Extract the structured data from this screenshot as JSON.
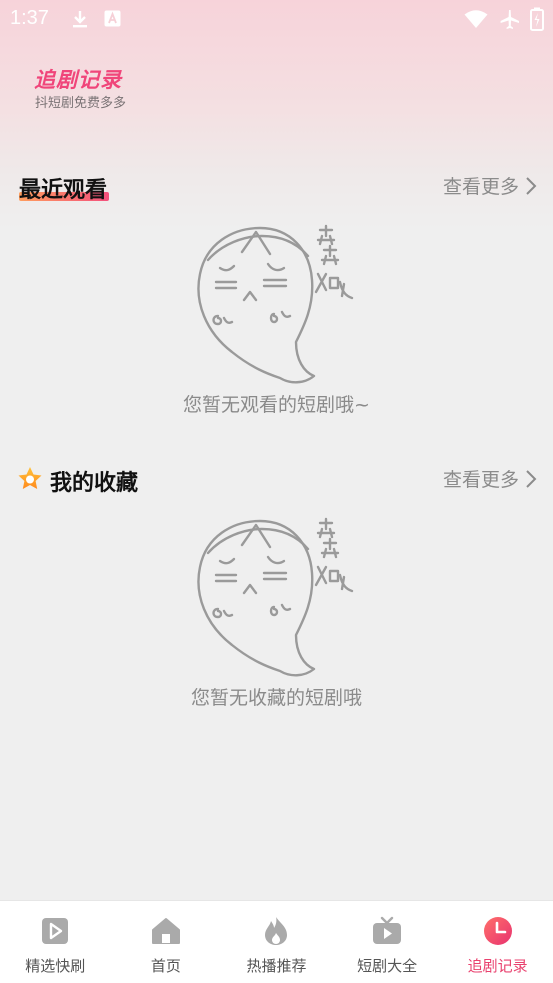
{
  "status_bar": {
    "time": "1:37",
    "left_icons": [
      "download-icon",
      "a-notification-icon"
    ],
    "right_icons": [
      "wifi-icon",
      "airplane-icon",
      "battery-icon"
    ]
  },
  "header": {
    "title": "追剧记录",
    "subtitle": "抖短剧免费多多"
  },
  "recent": {
    "title": "最近观看",
    "see_more": "查看更多",
    "empty_text": "您暂无观看的短剧哦~",
    "ghost_text": "空空如也"
  },
  "favorites": {
    "title": "我的收藏",
    "see_more": "查看更多",
    "empty_text": "您暂无收藏的短剧哦",
    "ghost_text": "空空如也"
  },
  "bottom_nav": {
    "items": [
      {
        "label": "精选快刷",
        "icon": "play-square-icon",
        "active": false
      },
      {
        "label": "首页",
        "icon": "home-icon",
        "active": false
      },
      {
        "label": "热播推荐",
        "icon": "flame-icon",
        "active": false
      },
      {
        "label": "短剧大全",
        "icon": "tv-icon",
        "active": false
      },
      {
        "label": "追剧记录",
        "icon": "clock-icon",
        "active": true
      }
    ]
  },
  "colors": {
    "accent": "#e9426f",
    "inactive_icon": "#aaaaaa",
    "background": "#efefef"
  }
}
